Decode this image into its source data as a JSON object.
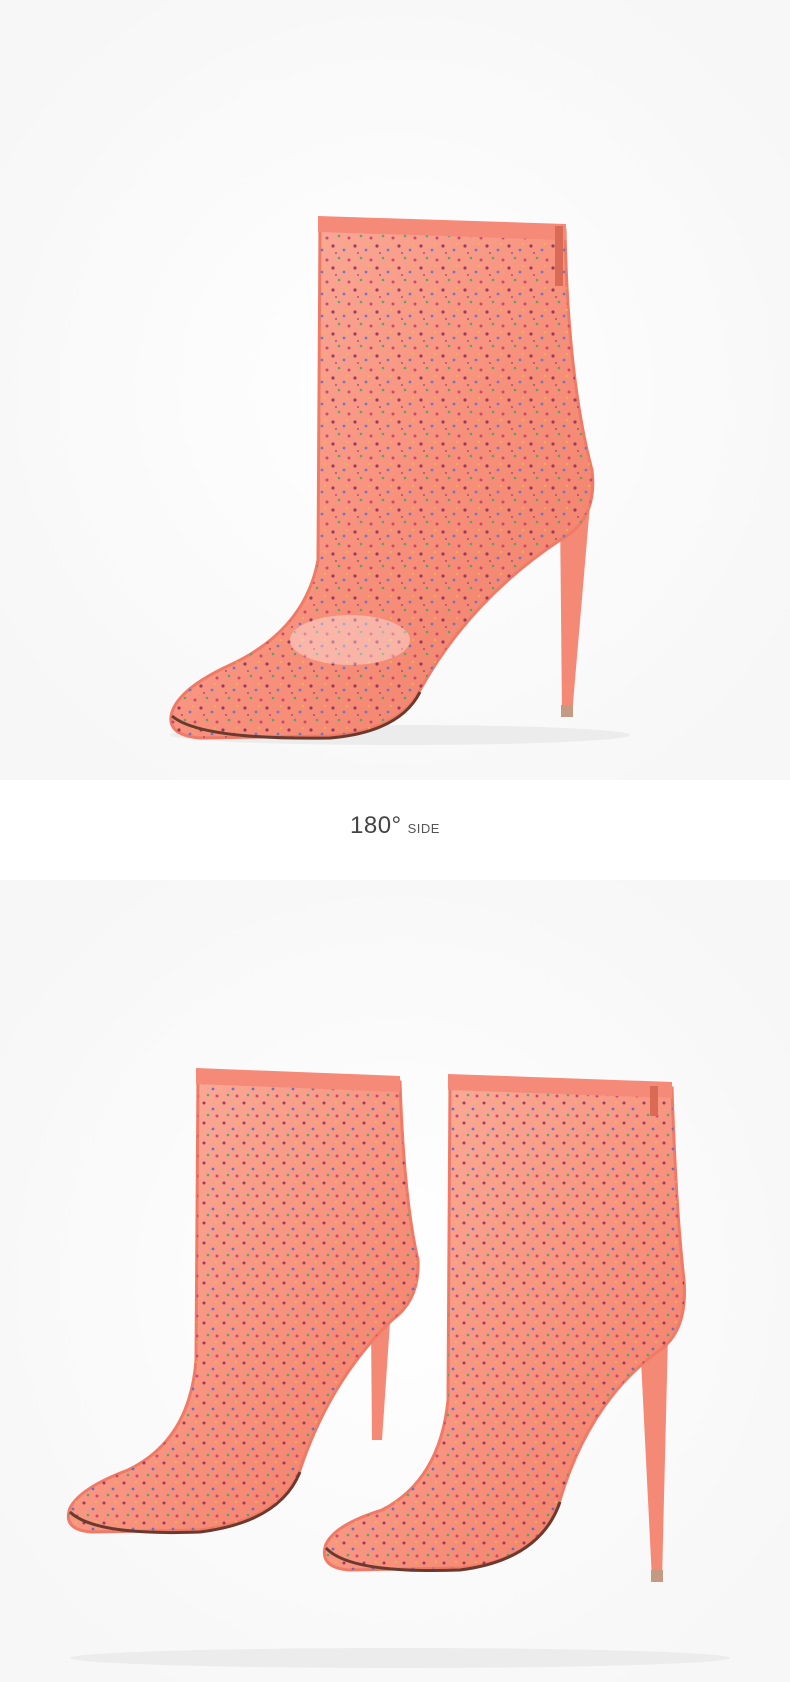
{
  "caption": {
    "degree": "180°",
    "view": "SIDE"
  },
  "colors": {
    "boot_base": "#f7907b",
    "boot_light": "#fbb3a1",
    "trim": "#f58a78",
    "sole": "#6b3a2f",
    "background": "#ffffff"
  }
}
